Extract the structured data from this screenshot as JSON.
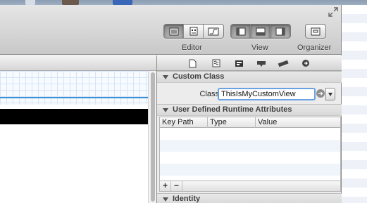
{
  "toolbar": {
    "editor_label": "Editor",
    "view_label": "View",
    "organizer_label": "Organizer"
  },
  "inspector": {
    "custom_class": {
      "title": "Custom Class",
      "class_label": "Class",
      "class_value": "ThisIsMyCustomView"
    },
    "runtime_attributes": {
      "title": "User Defined Runtime Attributes",
      "columns": [
        "Key Path",
        "Type",
        "Value"
      ],
      "add_label": "+",
      "remove_label": "−"
    },
    "identity": {
      "title": "Identity"
    }
  },
  "colors": {
    "selection_blue": "#3d8fd6",
    "focus_ring": "#6aa1e3"
  }
}
